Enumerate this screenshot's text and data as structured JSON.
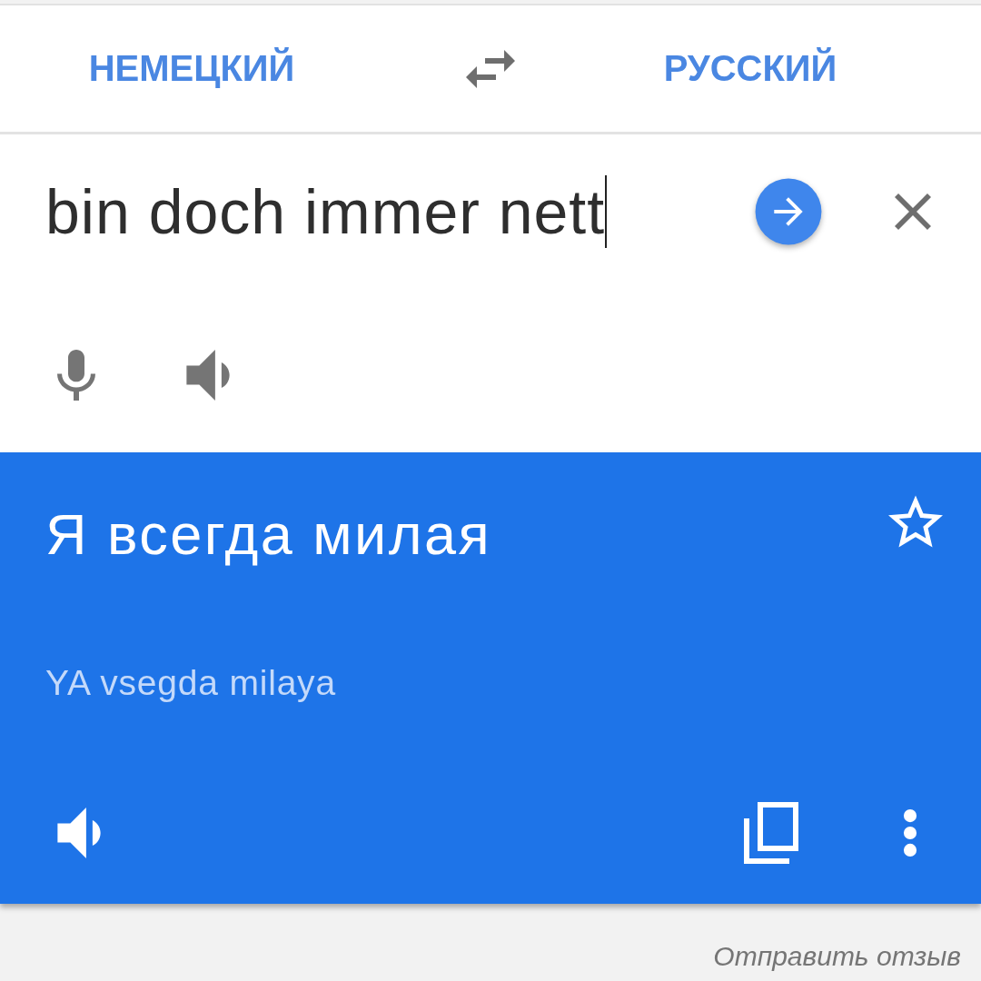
{
  "languages": {
    "source": "НЕМЕЦКИЙ",
    "target": "РУССКИЙ"
  },
  "input": {
    "value": "bin doch immer nett",
    "focused": true
  },
  "translation": {
    "text": "Я всегда милая",
    "transliteration": "YA vsegda milaya",
    "starred": false
  },
  "footer": {
    "feedback_link": "Отправить отзыв"
  }
}
